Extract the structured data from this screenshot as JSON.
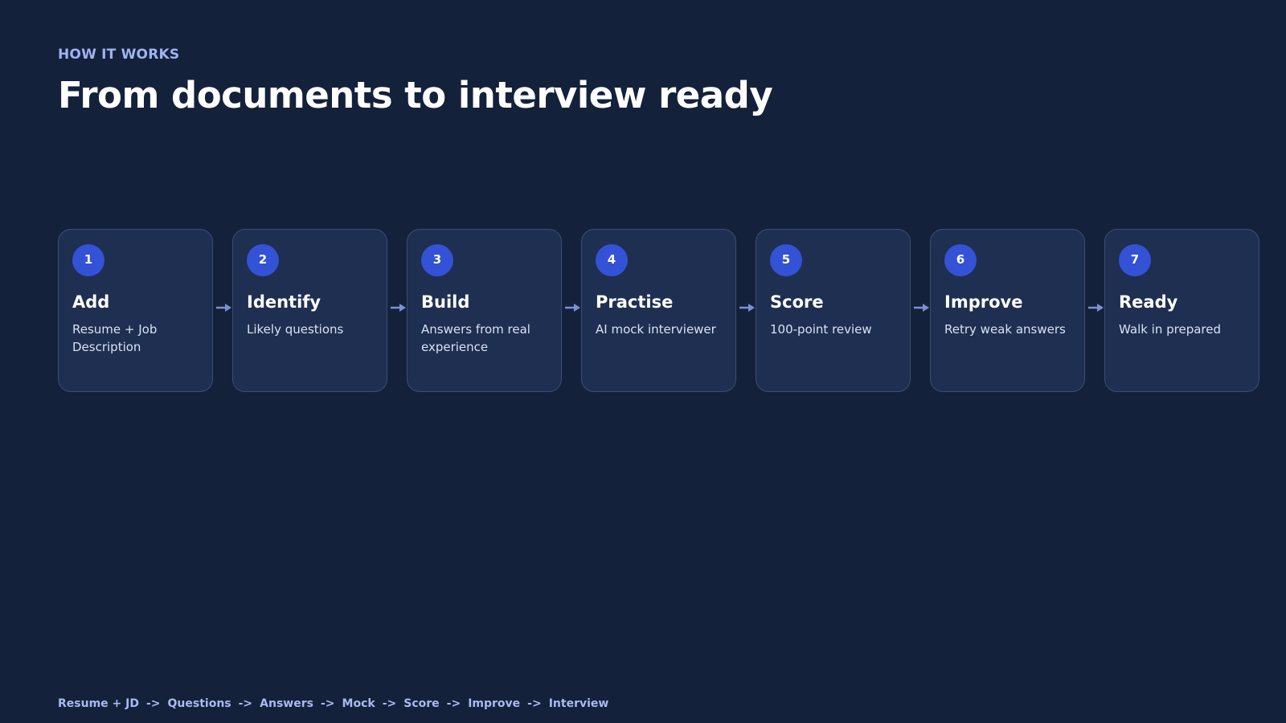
{
  "header": {
    "eyebrow": "HOW IT WORKS",
    "title": "From documents to interview ready"
  },
  "steps": [
    {
      "number": "1",
      "title": "Add",
      "description": "Resume + Job Description"
    },
    {
      "number": "2",
      "title": "Identify",
      "description": "Likely questions"
    },
    {
      "number": "3",
      "title": "Build",
      "description": "Answers from real experience"
    },
    {
      "number": "4",
      "title": "Practise",
      "description": "AI mock interviewer"
    },
    {
      "number": "5",
      "title": "Score",
      "description": "100-point review"
    },
    {
      "number": "6",
      "title": "Improve",
      "description": "Retry weak answers"
    },
    {
      "number": "7",
      "title": "Ready",
      "description": "Walk in prepared"
    }
  ],
  "flow": {
    "separator": "->",
    "items": [
      "Resume + JD",
      "Questions",
      "Answers",
      "Mock",
      "Score",
      "Improve",
      "Interview"
    ]
  },
  "colors": {
    "background": "#14213a",
    "card": "#1e2f51",
    "card_border": "#3a4d74",
    "badge": "#3352d5",
    "accent_text": "#9fb2f2",
    "arrow": "#7d8fd6"
  },
  "icons": {
    "connector": "arrow-right-icon"
  }
}
